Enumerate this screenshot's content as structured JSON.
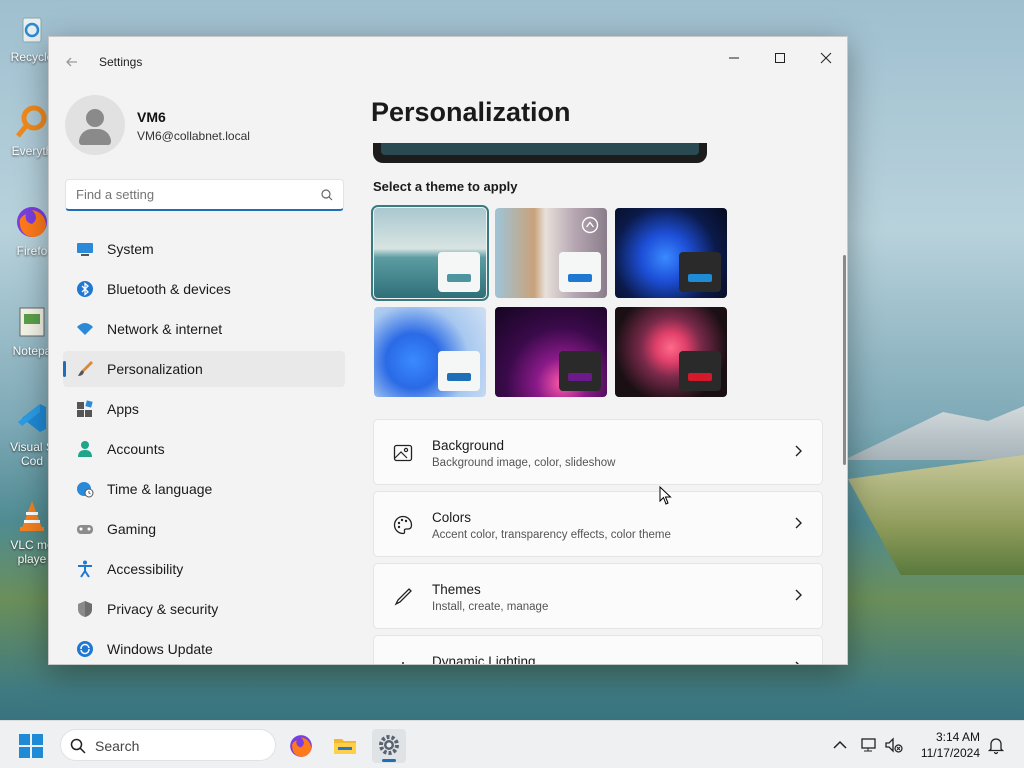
{
  "desktop": {
    "icons": [
      {
        "label": "Recycle",
        "label2": ""
      },
      {
        "label": "Everyth",
        "label2": ""
      },
      {
        "label": "Firefo",
        "label2": ""
      },
      {
        "label": "Notepa",
        "label2": ""
      },
      {
        "label": "Visual S",
        "label2": "Cod"
      },
      {
        "label": "VLC me",
        "label2": "playe"
      }
    ]
  },
  "window": {
    "title": "Settings",
    "back_icon": "arrow-left-icon",
    "controls": {
      "minimize": "—",
      "maximize": "☐",
      "close": "✕"
    }
  },
  "profile": {
    "name": "VM6",
    "email": "VM6@collabnet.local"
  },
  "search": {
    "placeholder": "Find a setting"
  },
  "nav": {
    "items": [
      {
        "label": "System",
        "icon": "monitor-icon"
      },
      {
        "label": "Bluetooth & devices",
        "icon": "bluetooth-icon"
      },
      {
        "label": "Network & internet",
        "icon": "wifi-icon"
      },
      {
        "label": "Personalization",
        "icon": "brush-icon",
        "active": true
      },
      {
        "label": "Apps",
        "icon": "apps-icon"
      },
      {
        "label": "Accounts",
        "icon": "person-icon"
      },
      {
        "label": "Time & language",
        "icon": "globe-clock-icon"
      },
      {
        "label": "Gaming",
        "icon": "gamepad-icon"
      },
      {
        "label": "Accessibility",
        "icon": "accessibility-icon"
      },
      {
        "label": "Privacy & security",
        "icon": "shield-icon"
      },
      {
        "label": "Windows Update",
        "icon": "update-icon"
      }
    ]
  },
  "main": {
    "title": "Personalization",
    "themes_label": "Select a theme to apply",
    "cards": [
      {
        "title": "Background",
        "subtitle": "Background image, color, slideshow",
        "icon": "image-icon"
      },
      {
        "title": "Colors",
        "subtitle": "Accent color, transparency effects, color theme",
        "icon": "palette-icon"
      },
      {
        "title": "Themes",
        "subtitle": "Install, create, manage",
        "icon": "pen-icon"
      },
      {
        "title": "Dynamic Lighting",
        "subtitle": "",
        "icon": "lighting-icon"
      }
    ]
  },
  "taskbar": {
    "search_label": "Search",
    "time": "3:14 AM",
    "date": "11/17/2024"
  },
  "colors": {
    "accent": "#1f6fb8",
    "selected_theme": "#3a7b80"
  }
}
